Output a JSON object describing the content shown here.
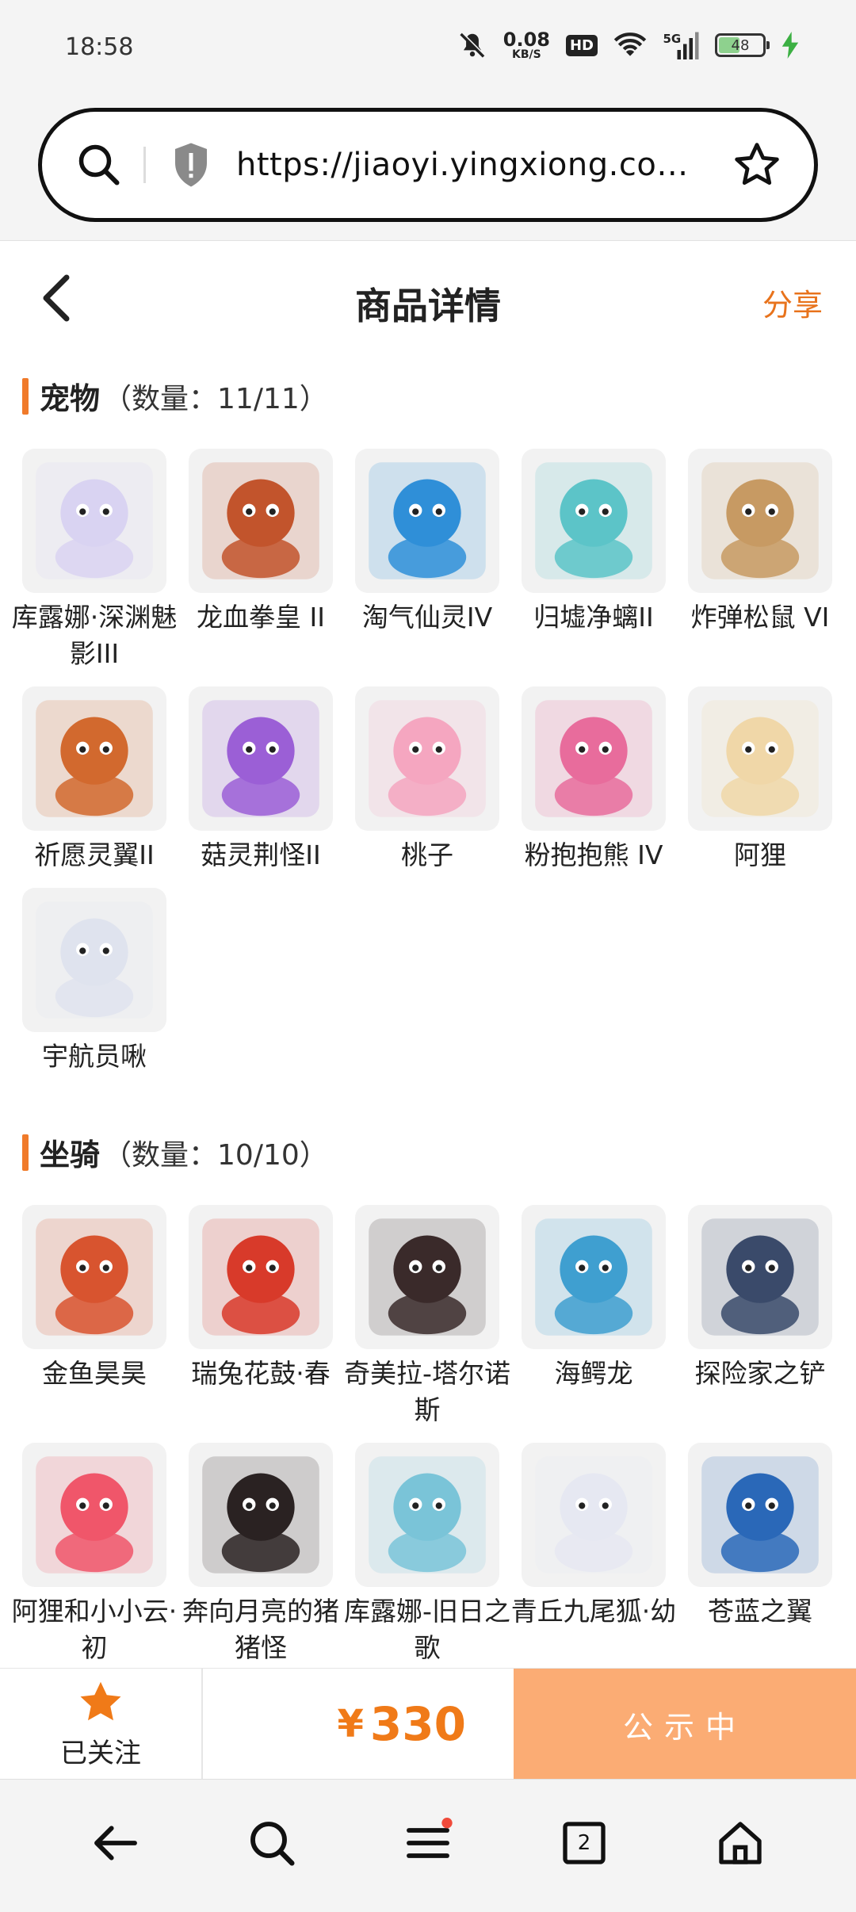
{
  "status_bar": {
    "time": "18:58",
    "net_speed": "0.08",
    "net_unit": "KB/S",
    "hd": "HD",
    "signal": "5G",
    "battery": "48"
  },
  "browser": {
    "url": "https://jiaoyi.yingxiong.com/g ...",
    "tab_count": "2"
  },
  "header": {
    "title": "商品详情",
    "share": "分享"
  },
  "pets": {
    "title": "宠物",
    "count": "（数量：11/11）",
    "items": [
      {
        "name": "库露娜·深渊魅影III",
        "color": "#d9d3f2"
      },
      {
        "name": "龙血拳皇 II",
        "color": "#c2542c"
      },
      {
        "name": "淘气仙灵IV",
        "color": "#2f8fd8"
      },
      {
        "name": "归墟净螭II",
        "color": "#5cc4c8"
      },
      {
        "name": "炸弹松鼠 VI",
        "color": "#c79a63"
      },
      {
        "name": "祈愿灵翼II",
        "color": "#d2692e"
      },
      {
        "name": "菇灵荆怪II",
        "color": "#9b5fd6"
      },
      {
        "name": "桃子",
        "color": "#f5a6c0"
      },
      {
        "name": "粉抱抱熊 IV",
        "color": "#e86c9c"
      },
      {
        "name": "阿狸",
        "color": "#f0d7a8"
      },
      {
        "name": "宇航员啾",
        "color": "#dfe3ee"
      }
    ]
  },
  "mounts": {
    "title": "坐骑",
    "count": "（数量：10/10）",
    "items": [
      {
        "name": "金鱼昊昊",
        "color": "#d8542f"
      },
      {
        "name": "瑞兔花鼓·春",
        "color": "#d83a2a"
      },
      {
        "name": "奇美拉-塔尔诺斯",
        "color": "#3a2a2a"
      },
      {
        "name": "海鳄龙",
        "color": "#3f9fd0"
      },
      {
        "name": "探险家之铲",
        "color": "#3a4a6a"
      },
      {
        "name": "阿狸和小小云·初",
        "color": "#f0566a"
      },
      {
        "name": "奔向月亮的猪猪怪",
        "color": "#2a2222"
      },
      {
        "name": "库露娜-旧日之歌",
        "color": "#7ac4d8"
      },
      {
        "name": "青丘九尾狐·幼",
        "color": "#e6e8f2"
      },
      {
        "name": "苍蓝之翼",
        "color": "#2a68b8"
      }
    ]
  },
  "action_bar": {
    "follow_label": "已关注",
    "currency": "¥",
    "price": "330",
    "status": "公示中"
  },
  "colors": {
    "accent": "#f07a18",
    "status_button": "#fbac74"
  }
}
